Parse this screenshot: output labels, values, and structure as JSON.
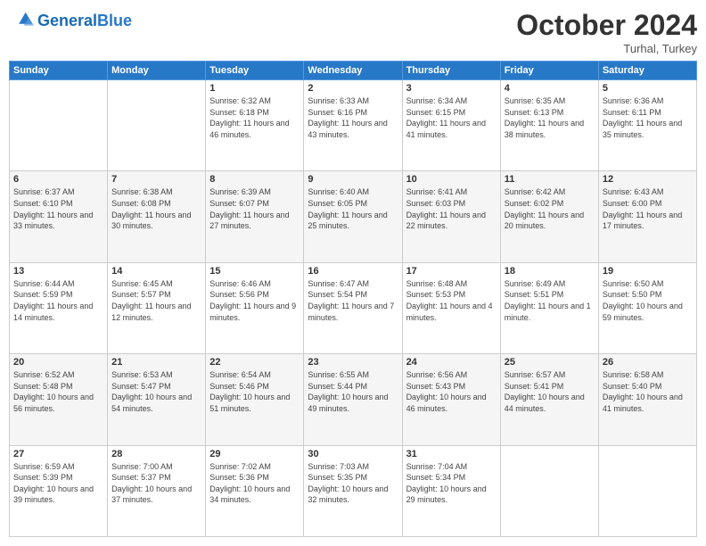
{
  "header": {
    "logo_line1": "General",
    "logo_line2": "Blue",
    "month_title": "October 2024",
    "subtitle": "Turhal, Turkey"
  },
  "days_of_week": [
    "Sunday",
    "Monday",
    "Tuesday",
    "Wednesday",
    "Thursday",
    "Friday",
    "Saturday"
  ],
  "weeks": [
    [
      {
        "day": "",
        "sunrise": "",
        "sunset": "",
        "daylight": ""
      },
      {
        "day": "",
        "sunrise": "",
        "sunset": "",
        "daylight": ""
      },
      {
        "day": "1",
        "sunrise": "Sunrise: 6:32 AM",
        "sunset": "Sunset: 6:18 PM",
        "daylight": "Daylight: 11 hours and 46 minutes."
      },
      {
        "day": "2",
        "sunrise": "Sunrise: 6:33 AM",
        "sunset": "Sunset: 6:16 PM",
        "daylight": "Daylight: 11 hours and 43 minutes."
      },
      {
        "day": "3",
        "sunrise": "Sunrise: 6:34 AM",
        "sunset": "Sunset: 6:15 PM",
        "daylight": "Daylight: 11 hours and 41 minutes."
      },
      {
        "day": "4",
        "sunrise": "Sunrise: 6:35 AM",
        "sunset": "Sunset: 6:13 PM",
        "daylight": "Daylight: 11 hours and 38 minutes."
      },
      {
        "day": "5",
        "sunrise": "Sunrise: 6:36 AM",
        "sunset": "Sunset: 6:11 PM",
        "daylight": "Daylight: 11 hours and 35 minutes."
      }
    ],
    [
      {
        "day": "6",
        "sunrise": "Sunrise: 6:37 AM",
        "sunset": "Sunset: 6:10 PM",
        "daylight": "Daylight: 11 hours and 33 minutes."
      },
      {
        "day": "7",
        "sunrise": "Sunrise: 6:38 AM",
        "sunset": "Sunset: 6:08 PM",
        "daylight": "Daylight: 11 hours and 30 minutes."
      },
      {
        "day": "8",
        "sunrise": "Sunrise: 6:39 AM",
        "sunset": "Sunset: 6:07 PM",
        "daylight": "Daylight: 11 hours and 27 minutes."
      },
      {
        "day": "9",
        "sunrise": "Sunrise: 6:40 AM",
        "sunset": "Sunset: 6:05 PM",
        "daylight": "Daylight: 11 hours and 25 minutes."
      },
      {
        "day": "10",
        "sunrise": "Sunrise: 6:41 AM",
        "sunset": "Sunset: 6:03 PM",
        "daylight": "Daylight: 11 hours and 22 minutes."
      },
      {
        "day": "11",
        "sunrise": "Sunrise: 6:42 AM",
        "sunset": "Sunset: 6:02 PM",
        "daylight": "Daylight: 11 hours and 20 minutes."
      },
      {
        "day": "12",
        "sunrise": "Sunrise: 6:43 AM",
        "sunset": "Sunset: 6:00 PM",
        "daylight": "Daylight: 11 hours and 17 minutes."
      }
    ],
    [
      {
        "day": "13",
        "sunrise": "Sunrise: 6:44 AM",
        "sunset": "Sunset: 5:59 PM",
        "daylight": "Daylight: 11 hours and 14 minutes."
      },
      {
        "day": "14",
        "sunrise": "Sunrise: 6:45 AM",
        "sunset": "Sunset: 5:57 PM",
        "daylight": "Daylight: 11 hours and 12 minutes."
      },
      {
        "day": "15",
        "sunrise": "Sunrise: 6:46 AM",
        "sunset": "Sunset: 5:56 PM",
        "daylight": "Daylight: 11 hours and 9 minutes."
      },
      {
        "day": "16",
        "sunrise": "Sunrise: 6:47 AM",
        "sunset": "Sunset: 5:54 PM",
        "daylight": "Daylight: 11 hours and 7 minutes."
      },
      {
        "day": "17",
        "sunrise": "Sunrise: 6:48 AM",
        "sunset": "Sunset: 5:53 PM",
        "daylight": "Daylight: 11 hours and 4 minutes."
      },
      {
        "day": "18",
        "sunrise": "Sunrise: 6:49 AM",
        "sunset": "Sunset: 5:51 PM",
        "daylight": "Daylight: 11 hours and 1 minute."
      },
      {
        "day": "19",
        "sunrise": "Sunrise: 6:50 AM",
        "sunset": "Sunset: 5:50 PM",
        "daylight": "Daylight: 10 hours and 59 minutes."
      }
    ],
    [
      {
        "day": "20",
        "sunrise": "Sunrise: 6:52 AM",
        "sunset": "Sunset: 5:48 PM",
        "daylight": "Daylight: 10 hours and 56 minutes."
      },
      {
        "day": "21",
        "sunrise": "Sunrise: 6:53 AM",
        "sunset": "Sunset: 5:47 PM",
        "daylight": "Daylight: 10 hours and 54 minutes."
      },
      {
        "day": "22",
        "sunrise": "Sunrise: 6:54 AM",
        "sunset": "Sunset: 5:46 PM",
        "daylight": "Daylight: 10 hours and 51 minutes."
      },
      {
        "day": "23",
        "sunrise": "Sunrise: 6:55 AM",
        "sunset": "Sunset: 5:44 PM",
        "daylight": "Daylight: 10 hours and 49 minutes."
      },
      {
        "day": "24",
        "sunrise": "Sunrise: 6:56 AM",
        "sunset": "Sunset: 5:43 PM",
        "daylight": "Daylight: 10 hours and 46 minutes."
      },
      {
        "day": "25",
        "sunrise": "Sunrise: 6:57 AM",
        "sunset": "Sunset: 5:41 PM",
        "daylight": "Daylight: 10 hours and 44 minutes."
      },
      {
        "day": "26",
        "sunrise": "Sunrise: 6:58 AM",
        "sunset": "Sunset: 5:40 PM",
        "daylight": "Daylight: 10 hours and 41 minutes."
      }
    ],
    [
      {
        "day": "27",
        "sunrise": "Sunrise: 6:59 AM",
        "sunset": "Sunset: 5:39 PM",
        "daylight": "Daylight: 10 hours and 39 minutes."
      },
      {
        "day": "28",
        "sunrise": "Sunrise: 7:00 AM",
        "sunset": "Sunset: 5:37 PM",
        "daylight": "Daylight: 10 hours and 37 minutes."
      },
      {
        "day": "29",
        "sunrise": "Sunrise: 7:02 AM",
        "sunset": "Sunset: 5:36 PM",
        "daylight": "Daylight: 10 hours and 34 minutes."
      },
      {
        "day": "30",
        "sunrise": "Sunrise: 7:03 AM",
        "sunset": "Sunset: 5:35 PM",
        "daylight": "Daylight: 10 hours and 32 minutes."
      },
      {
        "day": "31",
        "sunrise": "Sunrise: 7:04 AM",
        "sunset": "Sunset: 5:34 PM",
        "daylight": "Daylight: 10 hours and 29 minutes."
      },
      {
        "day": "",
        "sunrise": "",
        "sunset": "",
        "daylight": ""
      },
      {
        "day": "",
        "sunrise": "",
        "sunset": "",
        "daylight": ""
      }
    ]
  ]
}
